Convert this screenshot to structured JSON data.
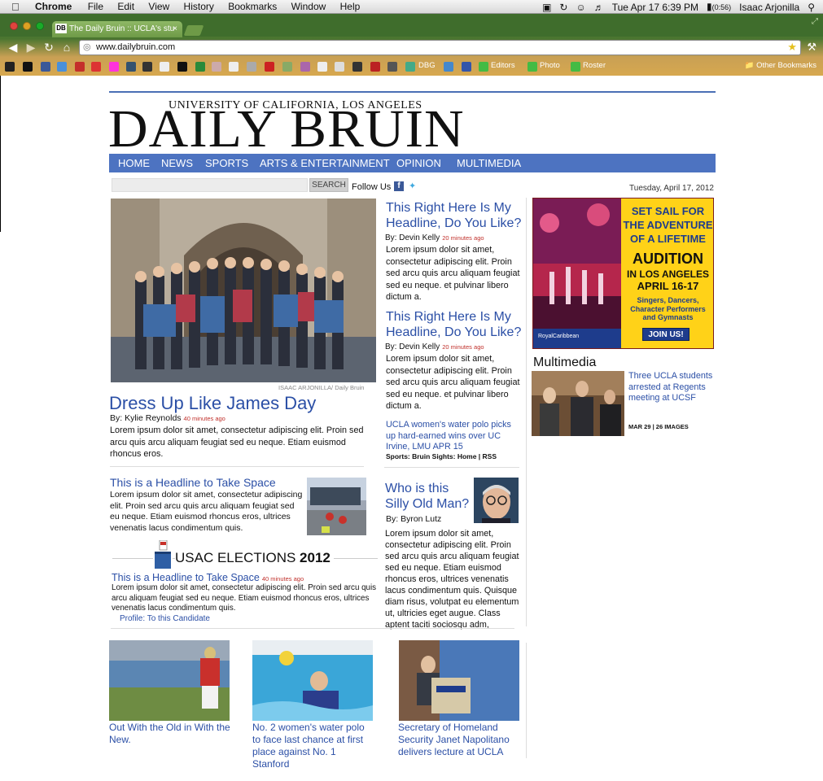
{
  "menubar": {
    "app": "Chrome",
    "menus": [
      "File",
      "Edit",
      "View",
      "History",
      "Bookmarks",
      "Window",
      "Help"
    ],
    "clock": "Tue Apr 17  6:39 PM",
    "battery": "(0:56)",
    "user": "Isaac Arjonilla"
  },
  "browser": {
    "tab_favicon": "DB",
    "tab_title": "The Daily Bruin :: UCLA's stu",
    "tab_close": "×",
    "url": "www.dailybruin.com",
    "bookmarks": {
      "dbg": "DBG",
      "editors": "Editors",
      "photo": "Photo",
      "roster": "Roster",
      "other": "Other Bookmarks"
    }
  },
  "masthead": {
    "university": "UNIVERSITY OF CALIFORNIA, LOS ANGELES",
    "name": "DAILY BRUIN"
  },
  "nav": [
    "HOME",
    "NEWS",
    "SPORTS",
    "ARTS & ENTERTAINMENT",
    "OPINION",
    "MULTIMEDIA"
  ],
  "toolbar": {
    "search_button": "SEARCH",
    "follow_us": "Follow Us",
    "date": "Tuesday, April 17, 2012"
  },
  "lead": {
    "photo_credit": "ISAAC ARJONILLA/ Daily Bruin",
    "headline": "Dress Up Like James Day",
    "byline": "By: Kylie Reynolds",
    "ago": "40 minutes ago",
    "body": "Lorem ipsum dolor sit amet, consectetur adipiscing elit. Proin sed arcu quis arcu aliquam feugiat sed eu neque. Etiam euismod rhoncus eros."
  },
  "second": {
    "headline": "This is a Headline to Take Space",
    "body": "Lorem ipsum dolor sit amet,  consectetur adipiscing elit. Proin sed arcu quis arcu aliquam feugiat sed eu neque. Etiam euismod rhoncus eros, ultrices venenatis lacus condimentum quis."
  },
  "usac": {
    "title": "USAC ELECTIONS",
    "year": "2012",
    "headline": "This is a Headline to Take Space",
    "ago": "40 minutes ago",
    "body": "Lorem ipsum dolor sit amet,  consectetur adipiscing elit. Proin sed arcu quis arcu aliquam feugiat sed eu neque. Etiam euismod rhoncus eros, ultrices venenatis lacus condimentum quis.",
    "profile": "Profile: To this Candidate"
  },
  "middle": [
    {
      "headline": "This Right Here Is My Headline, Do You Like?",
      "byline": "By: Devin Kelly",
      "ago": "20 minutes ago",
      "body": "Lorem ipsum dolor sit amet, consectetur adipiscing elit. Proin sed arcu quis arcu aliquam feugiat sed eu neque. et pulvinar libero dictum a."
    },
    {
      "headline": "This Right Here Is My Headline, Do You Like?",
      "byline": "By: Devin Kelly",
      "ago": "20 minutes ago",
      "body": "Lorem ipsum dolor sit amet, consectetur adipiscing elit. Proin sed arcu quis arcu aliquam feugiat sed eu neque. et pulvinar libero dictum a."
    }
  ],
  "waterpolo": {
    "headline": "UCLA women's water polo picks up hard-earned wins over UC Irvine, LMU APR 15",
    "meta": "Sports: Bruin Sights: Home | RSS"
  },
  "who": {
    "headline": "Who is this Silly Old Man?",
    "byline": "By: Byron Lutz",
    "body": "Lorem ipsum dolor sit amet, consectetur adipiscing elit. Proin sed arcu quis arcu aliquam feugiat sed eu neque. Etiam euismod rhoncus eros, ultrices venenatis lacus condimentum quis. Quisque diam risus, volutpat eu elementum ut, ultricies eget augue. Class aptent taciti sociosqu adm,"
  },
  "ad": {
    "line1": "SET SAIL FOR",
    "line2": "THE ADVENTURE",
    "line3": "OF A LIFETIME",
    "audition": "AUDITION",
    "location": "IN LOS ANGELES",
    "dates": "APRIL 16-17",
    "roles": "Singers, Dancers, Character Performers and Gymnasts",
    "join": "JOIN US!",
    "brand": "RoyalCaribbean"
  },
  "multimedia": {
    "title": "Multimedia",
    "headline": "Three UCLA students arrested at Regents meeting at UCSF",
    "meta": "MAR 29 | 26 IMAGES"
  },
  "bottom": [
    {
      "caption": "Out With the Old in With the New."
    },
    {
      "caption": "No. 2 women's water polo to face last chance at first place against No. 1 Stanford"
    },
    {
      "caption": "Secretary of Homeland Security Janet Napolitano delivers lecture at UCLA"
    }
  ]
}
